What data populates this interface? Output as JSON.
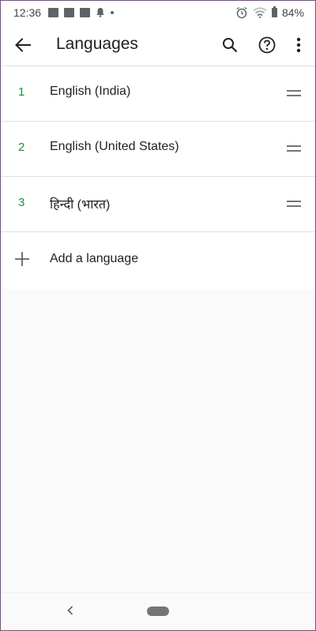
{
  "status_bar": {
    "time": "12:36",
    "battery": "84%"
  },
  "app_bar": {
    "title": "Languages"
  },
  "languages": [
    {
      "number": "1",
      "name": "English (India)"
    },
    {
      "number": "2",
      "name": "English (United States)"
    },
    {
      "number": "3",
      "name": "हिन्दी (भारत)"
    }
  ],
  "add_language_label": "Add a language",
  "colors": {
    "number_accent": "#1e8e3e",
    "text_primary": "#202124",
    "icon": "#5f6368"
  },
  "icons": {
    "back": "arrow-left-icon",
    "search": "search-icon",
    "help": "help-circle-icon",
    "overflow": "more-vertical-icon",
    "drag": "drag-handle-icon",
    "add": "plus-icon"
  }
}
